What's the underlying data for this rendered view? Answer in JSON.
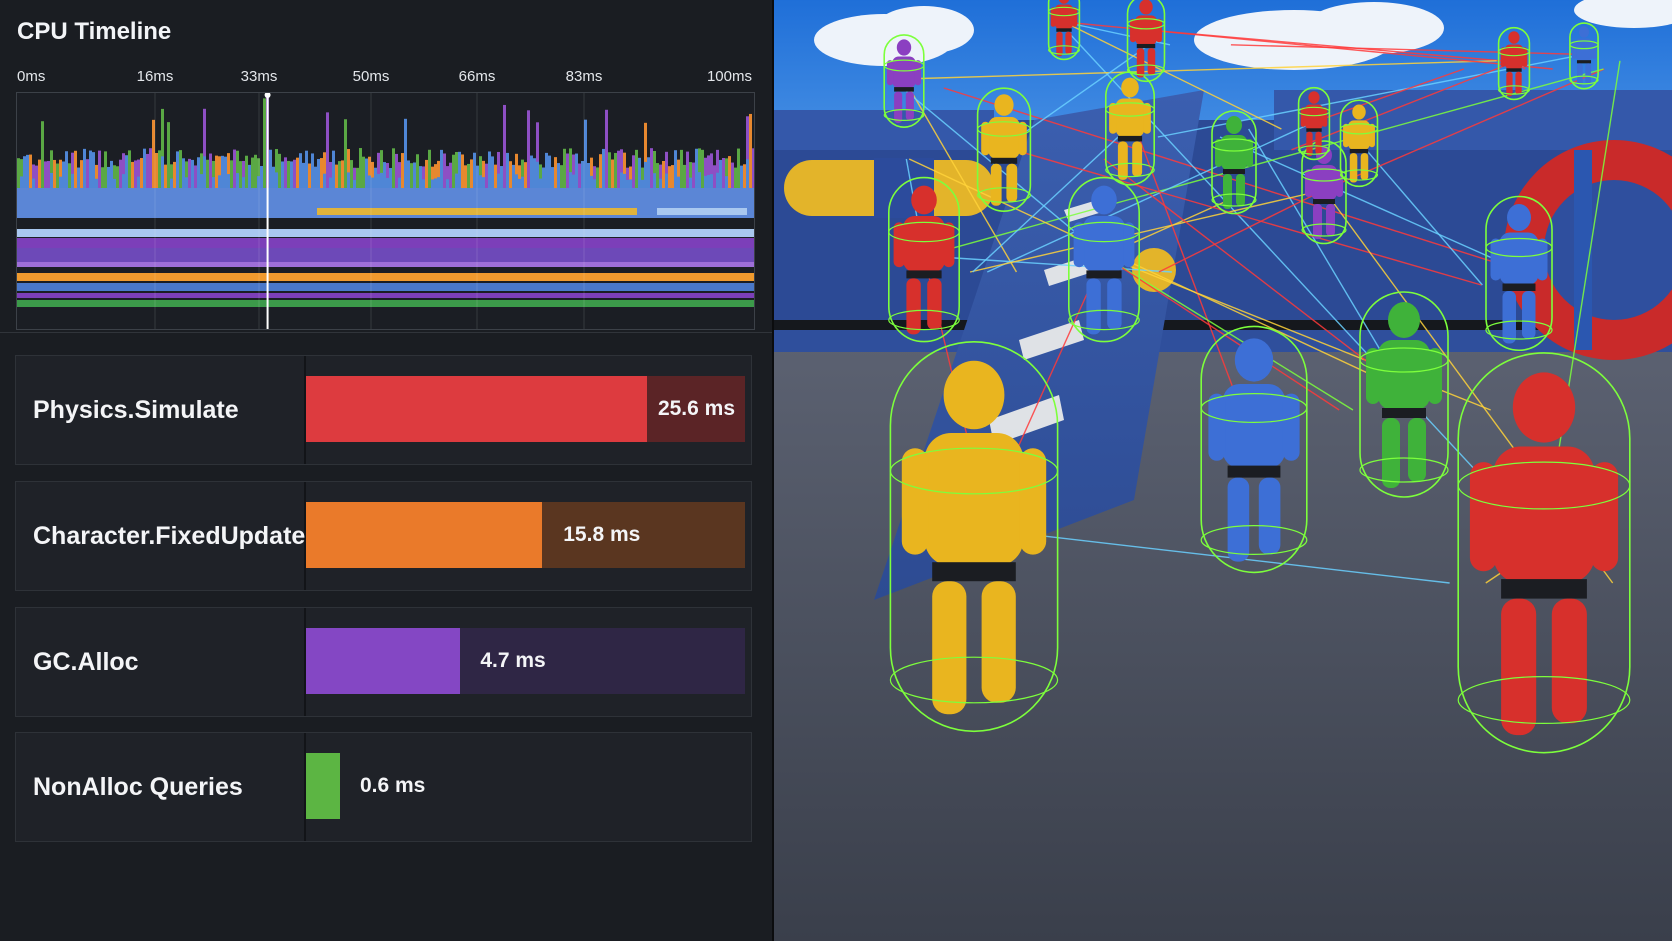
{
  "profiler": {
    "title": "CPU Timeline",
    "ruler_ticks": [
      "0ms",
      "16ms",
      "33ms",
      "50ms",
      "66ms",
      "83ms",
      "100ms"
    ],
    "timeline": {
      "range_ms": [
        0,
        100
      ],
      "cursor_ms": 34,
      "lane_colors": [
        "#5b86d6",
        "#e0b33c",
        "#a9c8f0",
        "#7c3fb9",
        "#9e6fd8",
        "#ef9a2e",
        "#6d49b8",
        "#4a78c9",
        "#3c9a4a",
        "#5aa844"
      ],
      "spike_colors": [
        "#5aa844",
        "#4f86d6",
        "#e7882f",
        "#8e4fc4"
      ]
    },
    "functions": [
      {
        "name": "Physics.Simulate",
        "time": "25.6 ms",
        "fraction": 0.776,
        "color": "#dd3b3f",
        "track_color": "#5b2426"
      },
      {
        "name": "Character.FixedUpdate",
        "time": "15.8 ms",
        "fraction": 0.538,
        "color": "#ea7a2a",
        "track_color": "#5a3620"
      },
      {
        "name": "GC.Alloc",
        "time": "4.7 ms",
        "fraction": 0.35,
        "color": "#8447c4",
        "track_color": "#2f2645"
      },
      {
        "name": "NonAlloc Queries",
        "time": "0.6 ms",
        "fraction": 0.077,
        "color": "#5cb543",
        "track_color": "#1f2228"
      }
    ]
  },
  "viewport": {
    "sky_color": "#2e7fe0",
    "ground_color": "#4a5060",
    "collider_color": "#7dff3c",
    "character_colors": [
      "#e9b51f",
      "#3d6fd6",
      "#d7302c",
      "#3fb23a",
      "#8b3fc1"
    ]
  }
}
